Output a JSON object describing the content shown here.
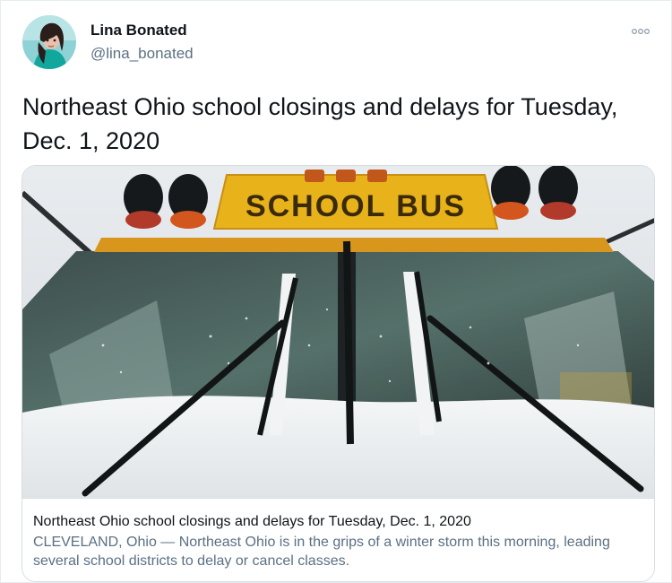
{
  "author": {
    "display_name": "Lina Bonated",
    "handle": "@lina_bonated",
    "avatar_icon": "avatar-photo"
  },
  "more_icon": "more-options-icon",
  "tweet": {
    "text": "Northeast Ohio school closings and delays for Tuesday, Dec. 1, 2020"
  },
  "card": {
    "image_description_icon": "school-bus-photo",
    "image_sign_text": "SCHOOL BUS",
    "title": "Northeast Ohio school closings and delays for Tuesday, Dec. 1, 2020",
    "description": "CLEVELAND, Ohio — Northeast Ohio is in the grips of a winter storm this morning, leading several school districts to delay or cancel classes."
  },
  "colors": {
    "primary_text": "#0f1419",
    "secondary_text": "#5b7083",
    "border": "#d7dde2",
    "bus_yellow": "#e8b21a"
  }
}
